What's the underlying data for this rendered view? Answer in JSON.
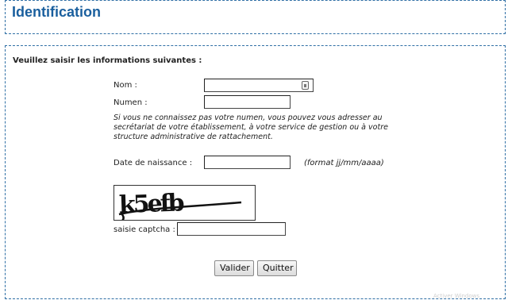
{
  "header": {
    "title": "Identification"
  },
  "form": {
    "heading": "Veuillez saisir les informations suivantes :",
    "nom_label": "Nom :",
    "numen_label": "Numen :",
    "numen_help": "Si vous ne connaissez pas votre numen, vous pouvez vous adresser au secrétariat de votre établissement, à votre service de gestion ou à votre structure administrative de rattachement.",
    "dob_label": "Date de naissance :",
    "dob_hint": "(format jj/mm/aaaa)",
    "captcha_text": "k5efb",
    "captcha_label": "saisie captcha :",
    "nom_value": "",
    "numen_value": "",
    "dob_value": "",
    "captcha_value": ""
  },
  "buttons": {
    "validate": "Valider",
    "quit": "Quitter"
  },
  "watermark": "Activer Windows",
  "colors": {
    "accent": "#1a5f9e",
    "frame": "#2f6fa5"
  },
  "icons": {
    "password_manager": "key-icon"
  }
}
